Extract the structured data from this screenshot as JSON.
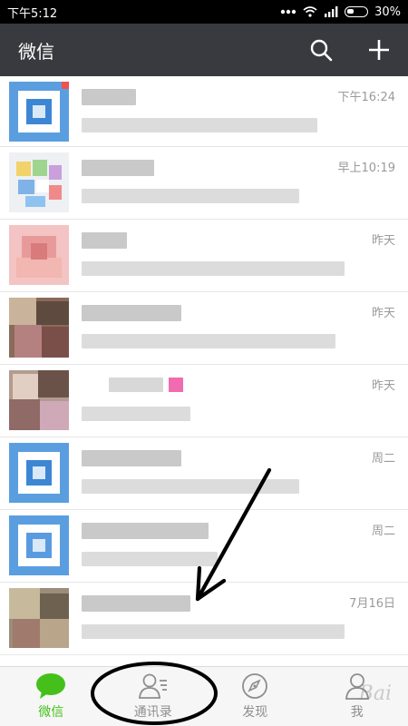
{
  "status_bar": {
    "time": "下午5:12",
    "battery": "30%"
  },
  "header": {
    "title": "微信",
    "icons": [
      "search-icon",
      "plus-icon"
    ]
  },
  "chats": [
    {
      "time": "下午16:24"
    },
    {
      "time": "早上10:19"
    },
    {
      "time": "昨天"
    },
    {
      "time": "昨天"
    },
    {
      "time": "昨天"
    },
    {
      "time": "周二"
    },
    {
      "time": "周二"
    },
    {
      "time": "7月16日"
    }
  ],
  "tabbar": {
    "tabs": [
      {
        "label": "微信",
        "icon": "chat-bubble-icon",
        "active": true
      },
      {
        "label": "通讯录",
        "icon": "contacts-icon",
        "active": false
      },
      {
        "label": "发现",
        "icon": "compass-icon",
        "active": false
      },
      {
        "label": "我",
        "icon": "person-icon",
        "active": false
      }
    ]
  },
  "colors": {
    "header_bg": "#393a3f",
    "accent": "#45c01a",
    "annotation": "#000000"
  }
}
